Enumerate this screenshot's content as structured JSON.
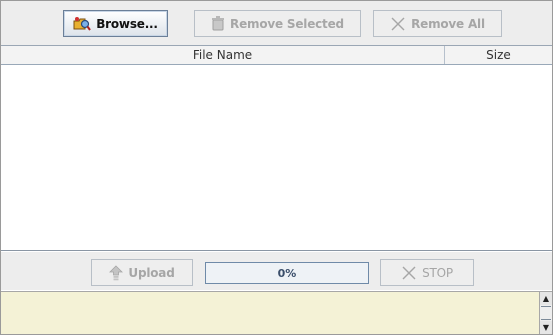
{
  "toolbar": {
    "browse_label": "Browse...",
    "remove_selected_label": "Remove Selected",
    "remove_all_label": "Remove All"
  },
  "table": {
    "columns": [
      "File Name",
      "Size"
    ],
    "rows": []
  },
  "actions": {
    "upload_label": "Upload",
    "progress_text": "0%",
    "progress_fraction": 0,
    "stop_label": "STOP"
  },
  "status": {
    "text": ""
  },
  "colors": {
    "status_background": "#f4f2d6",
    "disabled_text": "#a6a6a6",
    "progress_border": "#6f8aa8"
  }
}
